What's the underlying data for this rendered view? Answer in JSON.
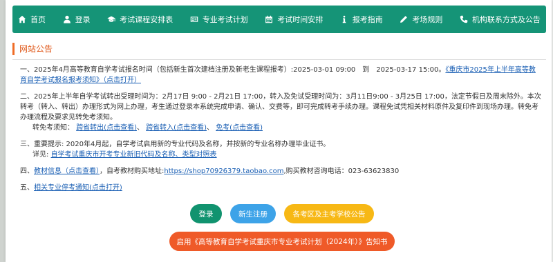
{
  "nav": {
    "items": [
      {
        "label": "首页",
        "icon": "home-icon"
      },
      {
        "label": "登录",
        "icon": "user-icon"
      },
      {
        "label": "考试课程安排表",
        "icon": "graduation-cap-icon"
      },
      {
        "label": "专业考试计划",
        "icon": "id-card-icon"
      },
      {
        "label": "考试时间安排",
        "icon": "calendar-icon"
      },
      {
        "label": "报考指南",
        "icon": "info-icon"
      },
      {
        "label": "考场规则",
        "icon": "pencil-icon"
      },
      {
        "label": "机构联系方式及公告",
        "icon": "phone-icon"
      }
    ]
  },
  "section_title": "网站公告",
  "p1": {
    "text": "一、2025年4月高等教育自学考试报名时间（包括新生首次建档注册及新老生课程报考）:2025-03-01 09:00　到　2025-03-17 15:00。",
    "link": "《重庆市2025年上半年高等教育自学考试报名报考须知》（点击打开）"
  },
  "p2": {
    "text": "二、2025年上半年自学考试转出受理时间为：2月17日 9:00 - 2月21日 17:00，转入及免试受理时间为：3月11日9:00 - 3月25日 17:00，法定节假日及周末除外。本次转考（转入、转出）办理形式为网上办理，考生通过登录本系统完成申请、确认、交费等，即可完成转考手续办理。课程免试凭相关材料原件及复印件到现场办理。转免考办理流程及要求见转免考须知。",
    "prefix": "转免考须知：",
    "link_out": "跨省转出(点击查看)",
    "link_in": "跨省转入(点击查看)",
    "link_exempt": "免考(点击查看)"
  },
  "p3": {
    "text": "三、重要提示: 2020年4月起，自学考试启用新的专业代码及名称，并按新的专业名称办理毕业证书。",
    "prefix": "详见:",
    "link": "自学考试重庆市开考专业新旧代码及名称、类型对照表"
  },
  "p4": {
    "prefix": "四、",
    "link": "教材信息（点击查看）",
    "text": "，自考教材购买地址:",
    "url": "https://shop70926379.taobao.com",
    "text2": ",购买教材咨询电话：023-63623830"
  },
  "p5": {
    "prefix": "五、",
    "link": "相关专业停考通知(点击打开)"
  },
  "buttons": {
    "login": "登录",
    "register": "新生注册",
    "notice": "各考区及主考学校公告",
    "plan": "启用《高等教育自学考试重庆市专业考试计划（2024年）》告知书"
  },
  "colors": {
    "nav_bg": "#159477",
    "title_accent": "#ef6c26",
    "link": "#1a5fb4",
    "btn_green": "#11936f",
    "btn_blue": "#3da3e8",
    "btn_orange": "#f7b815",
    "btn_red": "#ef5a28"
  }
}
